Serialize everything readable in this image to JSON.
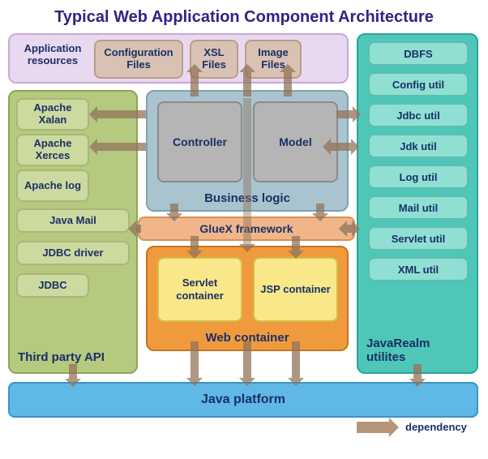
{
  "title": "Typical Web Application Component Architecture",
  "resources": {
    "group_label": "Application resources",
    "items": [
      "Configuration Files",
      "XSL Files",
      "Image Files"
    ]
  },
  "third_party": {
    "group_label": "Third party API",
    "items": [
      "Apache Xalan",
      "Apache Xerces",
      "Apache log",
      "Java Mail",
      "JDBC driver",
      "JDBC"
    ]
  },
  "utilities": {
    "group_label": "JavaRealm utilites",
    "items": [
      "DBFS",
      "Config util",
      "Jdbc util",
      "Jdk util",
      "Log util",
      "Mail util",
      "Servlet util",
      "XML util"
    ]
  },
  "business_logic": {
    "group_label": "Business logic",
    "controller": "Controller",
    "model": "Model"
  },
  "gluex": "GlueX  framework",
  "web_container": {
    "group_label": "Web container",
    "servlet": "Servlet container",
    "jsp": "JSP container"
  },
  "platform": "Java platform",
  "legend": "dependency",
  "colors": {
    "title": "#2e2585",
    "text": "#1a2f66",
    "arrow": "#b5957a"
  }
}
